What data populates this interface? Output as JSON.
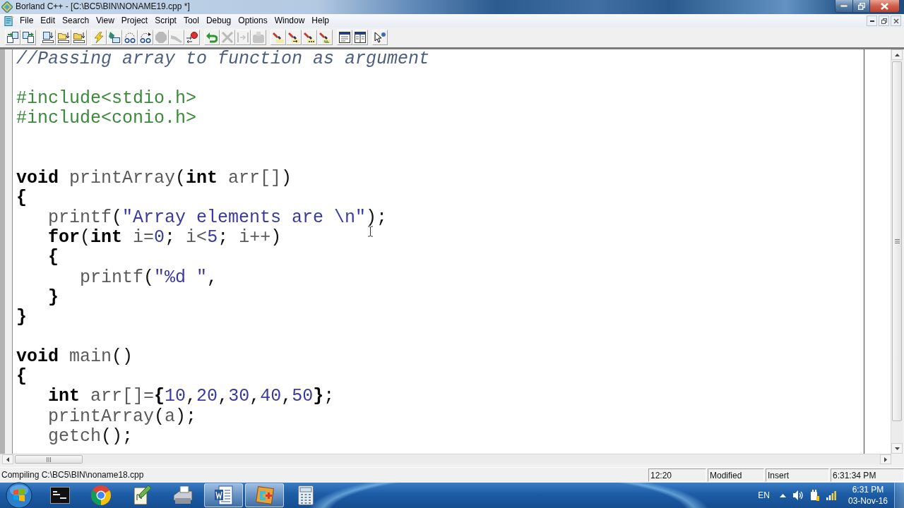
{
  "window": {
    "title": "Borland C++ - [C:\\BC5\\BIN\\NONAME19.cpp *]"
  },
  "menu": [
    "File",
    "Edit",
    "Search",
    "View",
    "Project",
    "Script",
    "Tool",
    "Debug",
    "Options",
    "Window",
    "Help"
  ],
  "toolbar": [
    {
      "buttons": [
        {
          "disabled": false
        },
        {
          "disabled": false
        }
      ]
    },
    {
      "buttons": [
        {
          "disabled": false
        },
        {
          "disabled": false
        },
        {
          "disabled": false
        }
      ]
    },
    {
      "buttons": [
        {
          "disabled": false
        },
        {
          "disabled": false
        },
        {
          "disabled": false
        },
        {
          "disabled": false
        },
        {
          "disabled": true
        },
        {
          "disabled": true
        },
        {
          "disabled": false
        }
      ]
    },
    {
      "buttons": [
        {
          "disabled": false
        },
        {
          "disabled": true
        },
        {
          "disabled": true
        },
        {
          "disabled": true
        }
      ]
    },
    {
      "buttons": [
        {
          "disabled": false
        },
        {
          "disabled": false
        },
        {
          "disabled": false
        },
        {
          "disabled": false
        }
      ]
    },
    {
      "buttons": [
        {
          "disabled": false
        },
        {
          "disabled": false
        }
      ]
    },
    {
      "buttons": [
        {
          "disabled": false
        }
      ]
    }
  ],
  "editor": {
    "lines": [
      {
        "kind": "code",
        "tokens": [
          {
            "kind": "comment",
            "text": "//Passing array to function as argument"
          }
        ]
      },
      {
        "kind": "blank"
      },
      {
        "kind": "code",
        "tokens": [
          {
            "kind": "preprocessor",
            "text": "#include<stdio.h>"
          }
        ]
      },
      {
        "kind": "code",
        "tokens": [
          {
            "kind": "preprocessor",
            "text": "#include<conio.h>"
          }
        ]
      },
      {
        "kind": "blank"
      },
      {
        "kind": "blank"
      },
      {
        "kind": "code",
        "tokens": [
          {
            "kind": "keyword",
            "text": "void"
          },
          {
            "kind": "identifier",
            "text": " printArray"
          },
          {
            "kind": "symbol",
            "text": "("
          },
          {
            "kind": "keyword",
            "text": "int"
          },
          {
            "kind": "identifier",
            "text": " arr[]"
          },
          {
            "kind": "symbol",
            "text": ")"
          }
        ]
      },
      {
        "kind": "code",
        "tokens": [
          {
            "kind": "brace",
            "text": "{"
          }
        ]
      },
      {
        "kind": "code",
        "tokens": [
          {
            "kind": "identifier",
            "text": "   printf"
          },
          {
            "kind": "symbol",
            "text": "("
          },
          {
            "kind": "string",
            "text": "\"Array elements are \\n\""
          },
          {
            "kind": "symbol",
            "text": ");"
          }
        ]
      },
      {
        "kind": "code",
        "tokens": [
          {
            "kind": "keyword",
            "text": "   for"
          },
          {
            "kind": "symbol",
            "text": "("
          },
          {
            "kind": "keyword",
            "text": "int"
          },
          {
            "kind": "identifier",
            "text": " i="
          },
          {
            "kind": "number",
            "text": "0"
          },
          {
            "kind": "symbol",
            "text": ";"
          },
          {
            "kind": "identifier",
            "text": " i<"
          },
          {
            "kind": "number",
            "text": "5"
          },
          {
            "kind": "symbol",
            "text": ";"
          },
          {
            "kind": "identifier",
            "text": " i++"
          },
          {
            "kind": "symbol",
            "text": ")"
          }
        ]
      },
      {
        "kind": "code",
        "tokens": [
          {
            "kind": "brace",
            "text": "   {"
          }
        ]
      },
      {
        "kind": "code",
        "tokens": [
          {
            "kind": "identifier",
            "text": "      printf"
          },
          {
            "kind": "symbol",
            "text": "("
          },
          {
            "kind": "string",
            "text": "\"%d \""
          },
          {
            "kind": "symbol",
            "text": ","
          }
        ]
      },
      {
        "kind": "code",
        "tokens": [
          {
            "kind": "brace",
            "text": "   }"
          }
        ]
      },
      {
        "kind": "code",
        "tokens": [
          {
            "kind": "brace",
            "text": "}"
          }
        ]
      },
      {
        "kind": "blank"
      },
      {
        "kind": "code",
        "tokens": [
          {
            "kind": "keyword",
            "text": "void"
          },
          {
            "kind": "identifier",
            "text": " main"
          },
          {
            "kind": "symbol",
            "text": "()"
          }
        ]
      },
      {
        "kind": "code",
        "tokens": [
          {
            "kind": "brace",
            "text": "{"
          }
        ]
      },
      {
        "kind": "code",
        "tokens": [
          {
            "kind": "keyword",
            "text": "   int"
          },
          {
            "kind": "identifier",
            "text": " arr[]="
          },
          {
            "kind": "brace",
            "text": "{"
          },
          {
            "kind": "number",
            "text": "10"
          },
          {
            "kind": "symbol",
            "text": ","
          },
          {
            "kind": "number",
            "text": "20"
          },
          {
            "kind": "symbol",
            "text": ","
          },
          {
            "kind": "number",
            "text": "30"
          },
          {
            "kind": "symbol",
            "text": ","
          },
          {
            "kind": "number",
            "text": "40"
          },
          {
            "kind": "symbol",
            "text": ","
          },
          {
            "kind": "number",
            "text": "50"
          },
          {
            "kind": "brace",
            "text": "}"
          },
          {
            "kind": "symbol",
            "text": ";"
          }
        ]
      },
      {
        "kind": "code",
        "tokens": [
          {
            "kind": "identifier",
            "text": "   printArray"
          },
          {
            "kind": "symbol",
            "text": "("
          },
          {
            "kind": "identifier",
            "text": "a"
          },
          {
            "kind": "symbol",
            "text": ");"
          }
        ]
      },
      {
        "kind": "code",
        "tokens": [
          {
            "kind": "identifier",
            "text": "   getch"
          },
          {
            "kind": "symbol",
            "text": "();"
          }
        ]
      }
    ]
  },
  "status_bar": {
    "message": "Compiling C:\\BC5\\BIN\\noname18.cpp",
    "panels": [
      "12:20",
      "Modified",
      "Insert",
      "6:31:34 PM"
    ]
  },
  "taskbar": {
    "apps": [
      {
        "selected": false
      },
      {
        "selected": false
      },
      {
        "selected": false
      },
      {
        "selected": false
      },
      {
        "selected": true
      },
      {
        "selected": true
      },
      {
        "selected": false
      }
    ],
    "tray": {
      "language": "EN",
      "time": "6:31 PM",
      "date": "03-Nov-16"
    }
  }
}
